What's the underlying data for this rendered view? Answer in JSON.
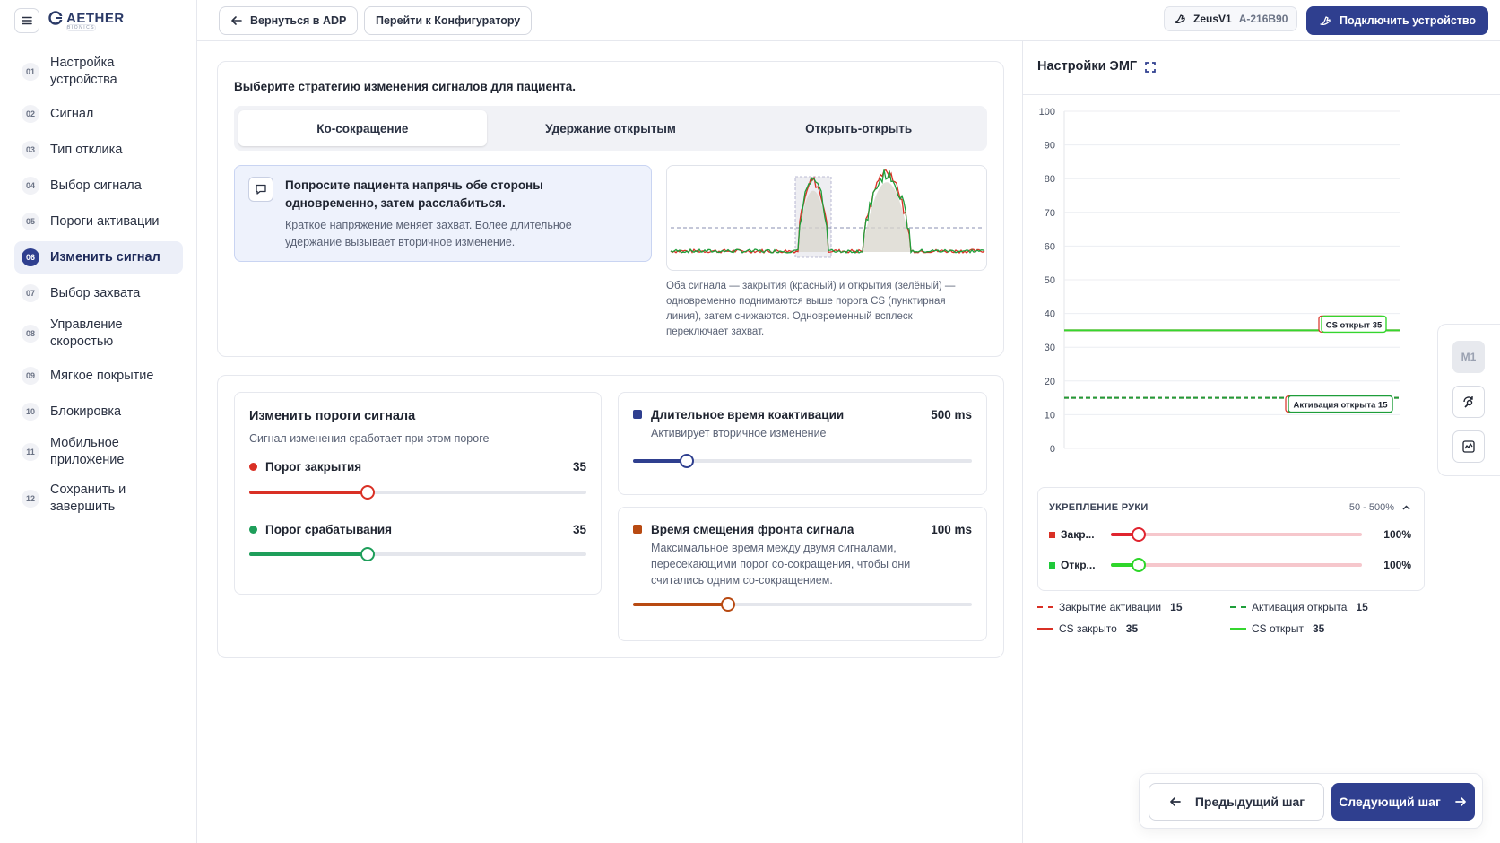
{
  "app": {
    "logo_text": "AETHER",
    "logo_sub": "BIONICS"
  },
  "sidebar": {
    "steps": [
      {
        "num": "01",
        "label": "Настройка устройства"
      },
      {
        "num": "02",
        "label": "Сигнал"
      },
      {
        "num": "03",
        "label": "Тип отклика"
      },
      {
        "num": "04",
        "label": "Выбор сигнала"
      },
      {
        "num": "05",
        "label": "Пороги активации"
      },
      {
        "num": "06",
        "label": "Изменить сигнал"
      },
      {
        "num": "07",
        "label": "Выбор захвата"
      },
      {
        "num": "08",
        "label": "Управление скоростью"
      },
      {
        "num": "09",
        "label": "Мягкое покрытие"
      },
      {
        "num": "10",
        "label": "Блокировка"
      },
      {
        "num": "11",
        "label": "Мобильное приложение"
      },
      {
        "num": "12",
        "label": "Сохранить и завершить"
      }
    ]
  },
  "topbar": {
    "back_label": "Вернуться в ADP",
    "config_label": "Перейти к Конфигуратору",
    "device_model": "ZeusV1",
    "device_serial": "A-216B90",
    "connect_label": "Подключить устройство"
  },
  "strategy": {
    "title": "Выберите стратегию изменения сигналов для пациента.",
    "tabs": [
      "Ко-сокращение",
      "Удержание открытым",
      "Открыть-открыть"
    ],
    "active_tab": 0,
    "hint_title": "Попросите пациента напрячь обе стороны одновременно, затем расслабиться.",
    "hint_body": "Краткое напряжение меняет захват. Более длительное удержание вызывает вторичное изменение.",
    "caption": "Оба сигнала — закрытия (красный) и открытия (зелёный) — одновременно поднимаются выше порога CS (пунктирная линия), затем снижаются. Одновременный всплеск переключает захват."
  },
  "thresholds": {
    "title": "Изменить пороги сигнала",
    "desc": "Сигнал изменения сработает при этом пороге",
    "close_label": "Порог закрытия",
    "close_value": "35",
    "close_fraction": 0.35,
    "open_label": "Порог срабатывания",
    "open_value": "35",
    "open_fraction": 0.35
  },
  "coactivation": {
    "title": "Длительное время коактивации",
    "desc": "Активирует вторичное изменение",
    "value": "500 ms",
    "fraction": 0.16
  },
  "offset": {
    "title": "Время смещения фронта сигнала",
    "desc": "Максимальное время между двумя сигналами, пересекающими порог со-сокращения, чтобы они считались одним со-сокращением.",
    "value": "100 ms",
    "fraction": 0.28
  },
  "emg": {
    "title": "Настройки ЭМГ",
    "tag_cs_open": "CS открыт 35",
    "tag_activation_open": "Активация открыта 15"
  },
  "chart_data": {
    "type": "line",
    "ylim": [
      0,
      100
    ],
    "yticks": [
      0,
      10,
      20,
      30,
      40,
      50,
      60,
      70,
      80,
      90,
      100
    ],
    "series": [
      {
        "name": "Закрытие активации",
        "values": [
          15
        ],
        "color": "#d93025",
        "style": "dashed"
      },
      {
        "name": "Активация открыта",
        "values": [
          15
        ],
        "color": "#1e9e3a",
        "style": "dashed"
      },
      {
        "name": "CS закрыто",
        "values": [
          35
        ],
        "color": "#d93025",
        "style": "solid"
      },
      {
        "name": "CS открыт",
        "values": [
          35
        ],
        "color": "#35d62f",
        "style": "solid"
      }
    ]
  },
  "hand": {
    "title": "УКРЕПЛЕНИЕ РУКИ",
    "range": "50 - 500%",
    "close_label": "Закр...",
    "close_pct": "100%",
    "close_fraction": 0.11,
    "open_label": "Откр...",
    "open_pct": "100%",
    "open_fraction": 0.11
  },
  "legend": [
    {
      "label": "Закрытие активации",
      "value": "15"
    },
    {
      "label": "Активация открыта",
      "value": "15"
    },
    {
      "label": "CS закрыто",
      "value": "35"
    },
    {
      "label": "CS открыт",
      "value": "35"
    }
  ],
  "tools": {
    "m1_label": "M1"
  },
  "nav": {
    "prev_label": "Предыдущий шаг",
    "next_label": "Следующий шаг"
  },
  "colors": {
    "primary": "#2f3f8f",
    "close": "#d93025",
    "open": "#1e9e3a",
    "cs_open": "#35d62f",
    "coact": "#2f3f8f",
    "offset": "#b84a12"
  }
}
